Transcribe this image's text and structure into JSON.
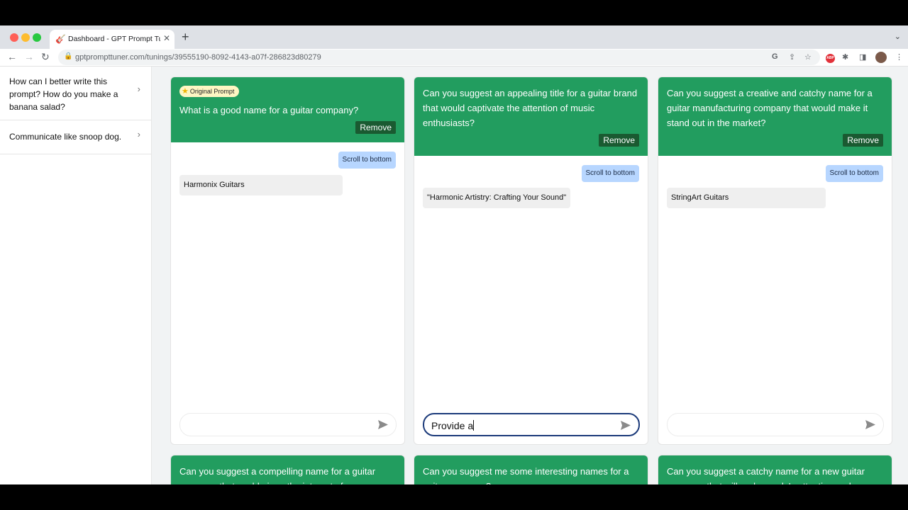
{
  "browser": {
    "tab_title": "Dashboard - GPT Prompt Tuner",
    "url": "gptprompttuner.com/tunings/39555190-8092-4143-a07f-286823d80279"
  },
  "sidebar": {
    "items": [
      {
        "label": "How can I better write this prompt? How do you make a banana salad?"
      },
      {
        "label": "Communicate like snoop dog."
      }
    ]
  },
  "cards": [
    {
      "badge": "Original Prompt",
      "prompt": "What is a good name for a guitar company?",
      "remove_label": "Remove",
      "scroll_label": "Scroll to bottom",
      "response": "Harmonix Guitars",
      "input_value": ""
    },
    {
      "prompt": "Can you suggest an appealing title for a guitar brand that would captivate the attention of music enthusiasts?",
      "remove_label": "Remove",
      "scroll_label": "Scroll to bottom",
      "response": "\"Harmonic Artistry: Crafting Your Sound\"",
      "input_value": "Provide a"
    },
    {
      "prompt": "Can you suggest a creative and catchy name for a guitar manufacturing company that would make it stand out in the market?",
      "remove_label": "Remove",
      "scroll_label": "Scroll to bottom",
      "response": "StringArt Guitars",
      "input_value": ""
    },
    {
      "prompt": "Can you suggest a compelling name for a guitar company that could pique the interest of"
    },
    {
      "prompt": "Can you suggest me some interesting names for a guitar company?"
    },
    {
      "prompt": "Can you suggest a catchy name for a new guitar company that will grab people's attention and"
    }
  ],
  "colors": {
    "card_header": "#229d5f",
    "remove_button": "#1a5a31",
    "scroll_button": "#b7d6ff",
    "badge": "#fef6c3"
  }
}
